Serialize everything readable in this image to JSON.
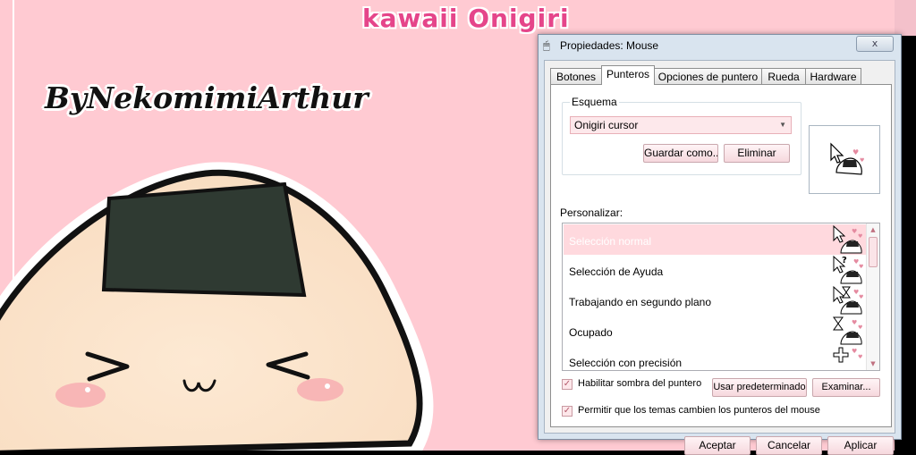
{
  "wallpaper": {
    "logo": "kawaii Onigiri",
    "signature": "ByNekomimiArthur"
  },
  "dialog": {
    "title": "Propiedades: Mouse",
    "close_label": "x",
    "tabs": [
      {
        "label": "Botones"
      },
      {
        "label": "Punteros",
        "active": true
      },
      {
        "label": "Opciones de puntero"
      },
      {
        "label": "Rueda"
      },
      {
        "label": "Hardware"
      }
    ],
    "scheme": {
      "legend": "Esquema",
      "selected": "Onigiri cursor",
      "save_as_label": "Guardar como...",
      "delete_label": "Eliminar"
    },
    "customize": {
      "label": "Personalizar:",
      "items": [
        {
          "label": "Selección normal",
          "selected": true,
          "icon": "arrow-onigiri-icon"
        },
        {
          "label": "Selección de Ayuda",
          "icon": "help-onigiri-icon"
        },
        {
          "label": "Trabajando en segundo plano",
          "icon": "working-onigiri-icon"
        },
        {
          "label": "Ocupado",
          "icon": "busy-onigiri-icon"
        },
        {
          "label": "Selección con precisión",
          "icon": "crosshair-icon"
        }
      ]
    },
    "shadow_checkbox": {
      "label": "Habilitar sombra del puntero",
      "checked": true
    },
    "use_default_label": "Usar predeterminado",
    "browse_label": "Examinar...",
    "themes_checkbox": {
      "label": "Permitir que los temas cambien los punteros del mouse",
      "checked": true
    },
    "buttons": {
      "ok": "Aceptar",
      "cancel": "Cancelar",
      "apply": "Aplicar"
    }
  },
  "colors": {
    "wallpaper_pink": "#ffcad2",
    "selection_pink": "#ffd9de",
    "onigiri_rice": "#fbe2c8",
    "nori": "#2f3a32"
  }
}
